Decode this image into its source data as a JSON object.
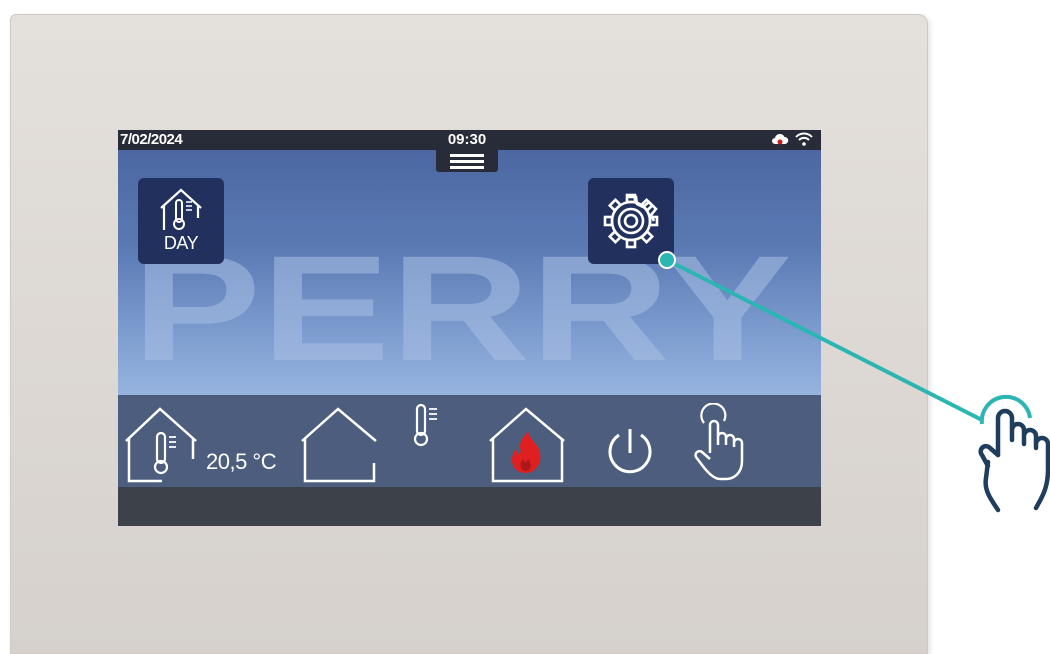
{
  "status_bar": {
    "date": "7/02/2024",
    "time": "09:30"
  },
  "tiles": {
    "day_label": "DAY"
  },
  "logo": {
    "text": "PERRY"
  },
  "bottom_bar": {
    "temperature": "20,5 °C"
  },
  "colors": {
    "panel": "#dcd7d3",
    "screen_top": "#4c67a2",
    "screen_bottom": "#97b4df",
    "tile": "#22305e",
    "bottom_bar": "#4d5d7d",
    "accent_line": "#2bb5b3",
    "flame": "#e02020",
    "hand_icon": "#1f3d5c"
  },
  "icons": [
    "thermometer-house-icon",
    "gear-icon",
    "house-icon",
    "thermometer-icon",
    "flame-house-icon",
    "power-icon",
    "touch-hand-icon",
    "cloud-alert-icon",
    "wifi-icon",
    "menu-icon"
  ]
}
